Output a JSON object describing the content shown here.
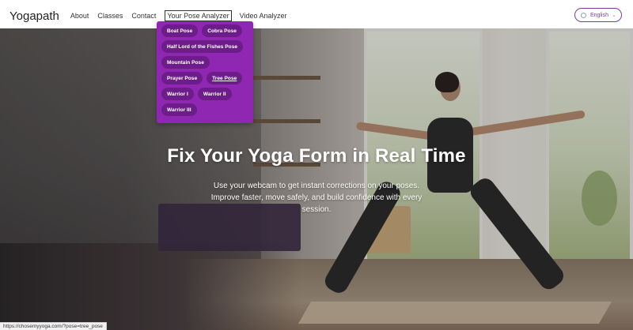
{
  "nav": {
    "brand": "Yogapath",
    "links": [
      "About",
      "Classes",
      "Contact",
      "Your Pose Analyzer",
      "Video Analyzer"
    ],
    "language": "English"
  },
  "dropdown": {
    "rows": [
      [
        "Boat Pose",
        "Cobra Pose"
      ],
      [
        "Half Lord of the Fishes Pose"
      ],
      [
        "Mountain Pose"
      ],
      [
        "Prayer Pose",
        "Tree Pose"
      ],
      [
        "Warrior I",
        "Warrior II"
      ],
      [
        "Warrior III"
      ]
    ],
    "hovered": "Tree Pose"
  },
  "hero": {
    "title": "Fix Your Yoga Form in Real Time",
    "subtitle": "Use your webcam to get instant corrections on your poses. Improve faster, move safely, and build confidence with every session."
  },
  "status_url": "https://chosemyyoga.com/?pose=tree_pose",
  "colors": {
    "accent": "#8f27b2",
    "pill": "#6c1d8a",
    "language_border": "#7a3a9e"
  },
  "icons": {
    "language": "globe-icon",
    "language_caret": "chevron-down-icon"
  }
}
